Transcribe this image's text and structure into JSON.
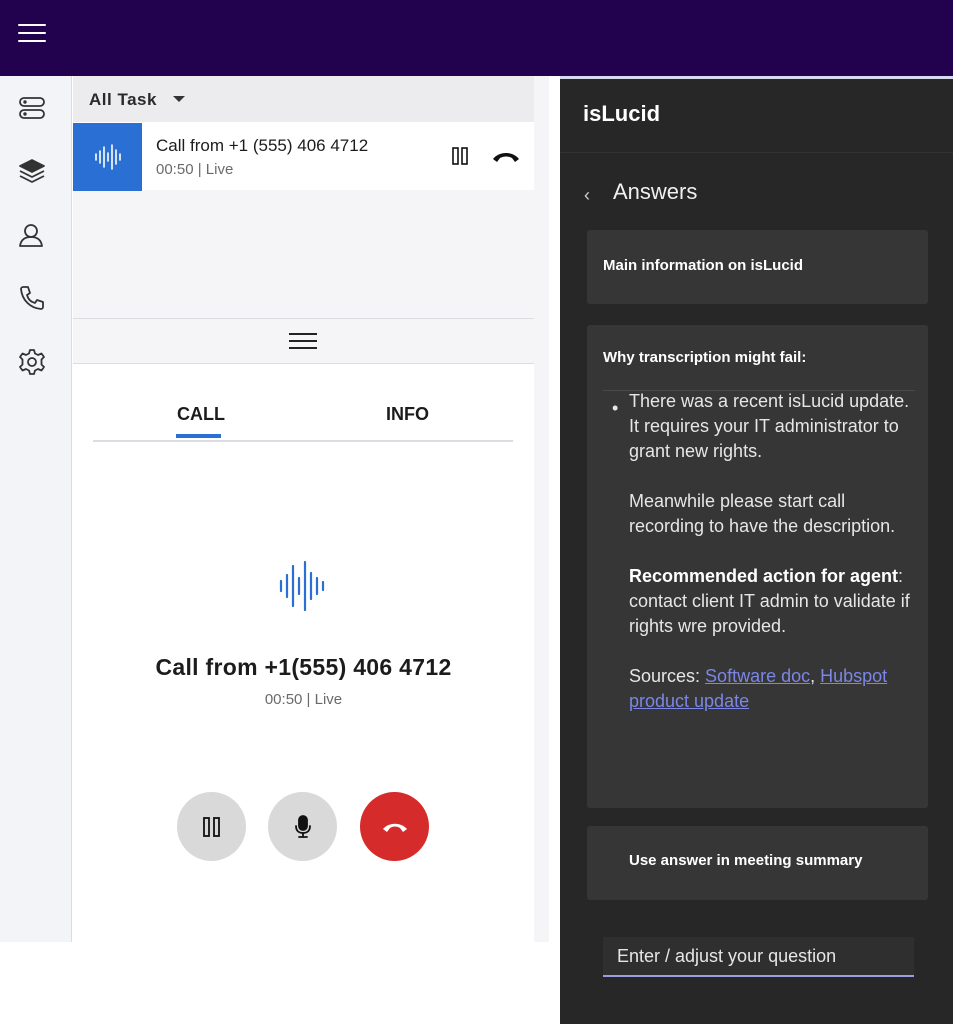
{
  "topbar": {
    "menu_icon": "hamburger-menu-icon"
  },
  "sidebar": {
    "icons": [
      "servers-icon",
      "layers-icon",
      "contact-icon",
      "phone-icon",
      "settings-icon"
    ]
  },
  "tasks": {
    "header": "All Task",
    "items": [
      {
        "title": "Call from +1 (555) 406 4712",
        "status": "00:50 | Live"
      }
    ]
  },
  "call": {
    "tabs": [
      {
        "label": "CALL",
        "active": true
      },
      {
        "label": "INFO",
        "active": false
      }
    ],
    "caller": "Call from +1(555) 406 4712",
    "status": "00:50 | Live"
  },
  "assistant": {
    "title": "isLucid",
    "section": "Answers",
    "card_main": "Main information on isLucid",
    "card_answer": {
      "heading": "Why transcription might fail:",
      "para1": "There was a recent isLucid update. It requires your IT administrator to grant new rights.",
      "para2": "Meanwhile please start call recording to have the description.",
      "action_label": "Recommended action for agent",
      "action_colon": ":",
      "action_text": "contact client IT admin to validate if rights wre provided.",
      "sources_label": "Sources: ",
      "source1": "Software doc",
      "sources_sep": ", ",
      "source2": "Hubspot product update"
    },
    "use_answer": "Use answer in meeting summary",
    "question_placeholder": "Enter / adjust your question"
  },
  "colors": {
    "topbar": "#22024f",
    "accent": "#2a6fd4",
    "end_call": "#d52b2b",
    "panel_dark": "#272727",
    "link": "#7b86e6"
  }
}
